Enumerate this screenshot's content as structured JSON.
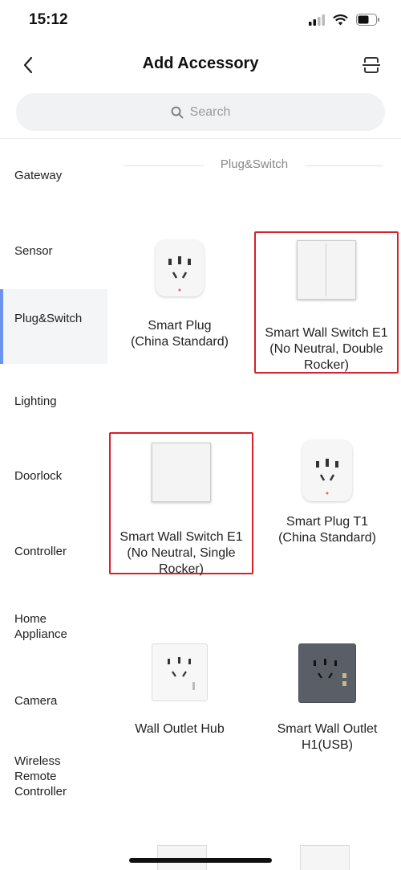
{
  "status": {
    "time": "15:12"
  },
  "header": {
    "title": "Add Accessory"
  },
  "search": {
    "placeholder": "Search"
  },
  "sidebar": {
    "items": [
      {
        "label": "Gateway"
      },
      {
        "label": "Sensor"
      },
      {
        "label": "Plug&Switch"
      },
      {
        "label": "Lighting"
      },
      {
        "label": "Doorlock"
      },
      {
        "label": "Controller"
      },
      {
        "label": "Home Appliance"
      },
      {
        "label": "Camera"
      },
      {
        "label": "Wireless Remote Controller"
      }
    ],
    "active_index": 2
  },
  "main": {
    "section_title": "Plug&Switch",
    "products": [
      {
        "name": "Smart Plug\n(China Standard)"
      },
      {
        "name": "Smart Wall Switch E1\n(No Neutral, Double\nRocker)"
      },
      {
        "name": "Smart Wall Switch E1\n(No Neutral, Single\nRocker)"
      },
      {
        "name": "Smart Plug T1\n(China Standard)"
      },
      {
        "name": "Wall Outlet Hub"
      },
      {
        "name": "Smart Wall Outlet\nH1(USB)"
      }
    ]
  },
  "colors": {
    "accent": "#6c93f0",
    "highlight": "#d6202a"
  }
}
